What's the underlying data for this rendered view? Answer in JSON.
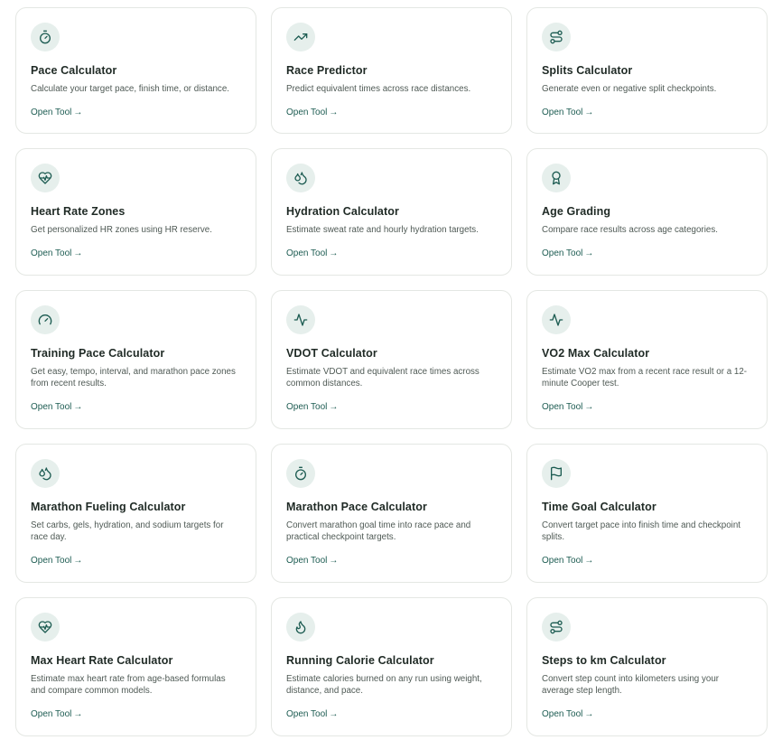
{
  "open_tool_label": "Open Tool",
  "link_arrow": "→",
  "accent_color": "#1d5c52",
  "icon_bg": "#e6efec",
  "cards": [
    {
      "title": "Pace Calculator",
      "description": "Calculate your target pace, finish time, or distance.",
      "icon": "stopwatch-icon"
    },
    {
      "title": "Race Predictor",
      "description": "Predict equivalent times across race distances.",
      "icon": "trending-up-icon"
    },
    {
      "title": "Splits Calculator",
      "description": "Generate even or negative split checkpoints.",
      "icon": "route-icon"
    },
    {
      "title": "Heart Rate Zones",
      "description": "Get personalized HR zones using HR reserve.",
      "icon": "heart-pulse-icon"
    },
    {
      "title": "Hydration Calculator",
      "description": "Estimate sweat rate and hourly hydration targets.",
      "icon": "droplets-icon"
    },
    {
      "title": "Age Grading",
      "description": "Compare race results across age categories.",
      "icon": "award-icon"
    },
    {
      "title": "Training Pace Calculator",
      "description": "Get easy, tempo, interval, and marathon pace zones from recent results.",
      "icon": "gauge-icon"
    },
    {
      "title": "VDOT Calculator",
      "description": "Estimate VDOT and equivalent race times across common distances.",
      "icon": "activity-icon"
    },
    {
      "title": "VO2 Max Calculator",
      "description": "Estimate VO2 max from a recent race result or a 12-minute Cooper test.",
      "icon": "activity-icon"
    },
    {
      "title": "Marathon Fueling Calculator",
      "description": "Set carbs, gels, hydration, and sodium targets for race day.",
      "icon": "droplets-icon"
    },
    {
      "title": "Marathon Pace Calculator",
      "description": "Convert marathon goal time into race pace and practical checkpoint targets.",
      "icon": "stopwatch-icon"
    },
    {
      "title": "Time Goal Calculator",
      "description": "Convert target pace into finish time and checkpoint splits.",
      "icon": "flag-icon"
    },
    {
      "title": "Max Heart Rate Calculator",
      "description": "Estimate max heart rate from age-based formulas and compare common models.",
      "icon": "heart-pulse-icon"
    },
    {
      "title": "Running Calorie Calculator",
      "description": "Estimate calories burned on any run using weight, distance, and pace.",
      "icon": "flame-icon"
    },
    {
      "title": "Steps to km Calculator",
      "description": "Convert step count into kilometers using your average step length.",
      "icon": "route-icon"
    }
  ]
}
